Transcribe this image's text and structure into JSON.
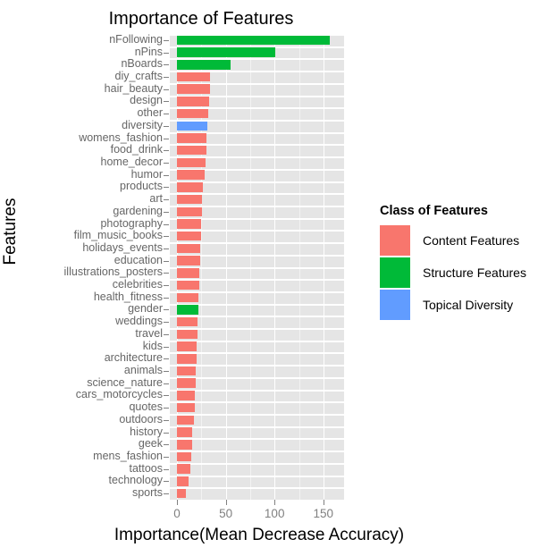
{
  "chart_data": {
    "type": "bar",
    "orientation": "horizontal",
    "title": "Importance of Features",
    "xlabel": "Importance(Mean Decrease Accuracy)",
    "ylabel": "Features",
    "xlim": [
      0,
      163
    ],
    "xticks": [
      0,
      50,
      100,
      150
    ],
    "xtick_labels": [
      "0",
      "50",
      "100",
      "150"
    ],
    "grid": true,
    "legend_position": "right",
    "categories": [
      "nFollowing",
      "nPins",
      "nBoards",
      "diy_crafts",
      "hair_beauty",
      "design",
      "other",
      "diversity",
      "womens_fashion",
      "food_drink",
      "home_decor",
      "humor",
      "products",
      "art",
      "gardening",
      "photography",
      "film_music_books",
      "holidays_events",
      "education",
      "illustrations_posters",
      "celebrities",
      "health_fitness",
      "gender",
      "weddings",
      "travel",
      "kids",
      "architecture",
      "animals",
      "science_nature",
      "cars_motorcycles",
      "quotes",
      "outdoors",
      "history",
      "geek",
      "mens_fashion",
      "tattoos",
      "technology",
      "sports"
    ],
    "values": [
      157,
      101,
      55,
      34,
      34,
      33,
      32,
      31,
      30,
      30,
      29,
      28,
      27,
      26,
      26,
      25,
      25,
      24,
      24,
      23,
      23,
      22,
      22,
      21,
      21,
      20,
      20,
      19,
      19,
      18,
      18,
      17,
      16,
      16,
      15,
      14,
      12,
      9
    ],
    "group_by_category": [
      "Structure Features",
      "Structure Features",
      "Structure Features",
      "Content Features",
      "Content Features",
      "Content Features",
      "Content Features",
      "Topical Diversity",
      "Content Features",
      "Content Features",
      "Content Features",
      "Content Features",
      "Content Features",
      "Content Features",
      "Content Features",
      "Content Features",
      "Content Features",
      "Content Features",
      "Content Features",
      "Content Features",
      "Content Features",
      "Content Features",
      "Structure Features",
      "Content Features",
      "Content Features",
      "Content Features",
      "Content Features",
      "Content Features",
      "Content Features",
      "Content Features",
      "Content Features",
      "Content Features",
      "Content Features",
      "Content Features",
      "Content Features",
      "Content Features",
      "Content Features",
      "Content Features"
    ]
  },
  "legend": {
    "title": "Class of Features",
    "entries": [
      {
        "label": "Content Features",
        "color": "#F8766D"
      },
      {
        "label": "Structure Features",
        "color": "#00BA38"
      },
      {
        "label": "Topical Diversity",
        "color": "#619CFF"
      }
    ]
  },
  "colors": {
    "content_features": "#F8766D",
    "structure_features": "#00BA38",
    "topical_diversity": "#619CFF",
    "panel_background": "#E5E5E5",
    "grid_line": "#FFFFFF",
    "axis_text": "#808080",
    "title_text": "#000000"
  }
}
